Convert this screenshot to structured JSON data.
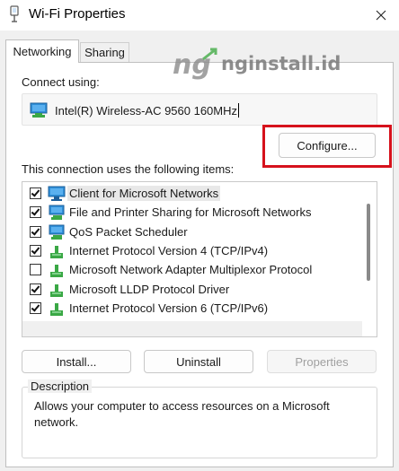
{
  "window": {
    "title": "Wi-Fi Properties"
  },
  "tabs": [
    {
      "label": "Networking",
      "active": true
    },
    {
      "label": "Sharing",
      "active": false
    }
  ],
  "connect_using": {
    "label": "Connect using:",
    "adapter": "Intel(R) Wireless-AC 9560 160MHz",
    "icon": "network-adapter-icon"
  },
  "buttons": {
    "configure": "Configure...",
    "install": "Install...",
    "uninstall": "Uninstall",
    "properties": "Properties"
  },
  "items_label": "This connection uses the following items:",
  "items": [
    {
      "label": "Client for Microsoft Networks",
      "checked": true,
      "icon": "network-client-icon",
      "selected": true
    },
    {
      "label": "File and Printer Sharing for Microsoft Networks",
      "checked": true,
      "icon": "network-service-icon"
    },
    {
      "label": "QoS Packet Scheduler",
      "checked": true,
      "icon": "network-service-icon"
    },
    {
      "label": "Internet Protocol Version 4 (TCP/IPv4)",
      "checked": true,
      "icon": "network-protocol-icon"
    },
    {
      "label": "Microsoft Network Adapter Multiplexor Protocol",
      "checked": false,
      "icon": "network-protocol-icon"
    },
    {
      "label": "Microsoft LLDP Protocol Driver",
      "checked": true,
      "icon": "network-protocol-icon"
    },
    {
      "label": "Internet Protocol Version 6 (TCP/IPv6)",
      "checked": true,
      "icon": "network-protocol-icon"
    }
  ],
  "description": {
    "legend": "Description",
    "text": "Allows your computer to access resources on a Microsoft network."
  },
  "watermark": {
    "text": "nginstall.id",
    "logo": "ng"
  },
  "colors": {
    "highlight": "#d6121c",
    "accent": "#0078d4",
    "protocol_green": "#3aa845"
  }
}
